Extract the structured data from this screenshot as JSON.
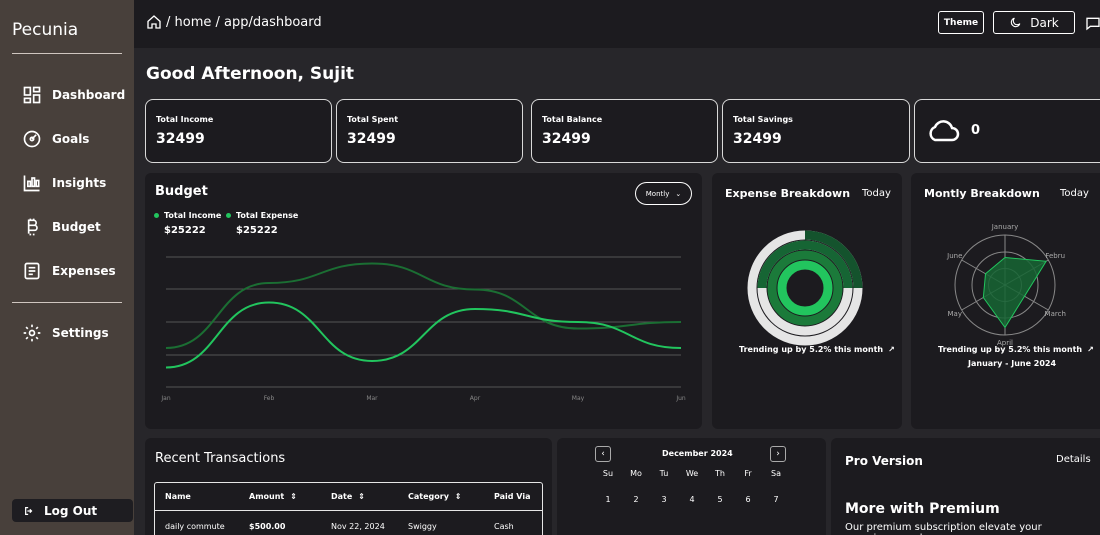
{
  "app": {
    "brand": "Pecunia"
  },
  "sidebar": {
    "items": [
      {
        "label": "Dashboard",
        "icon": "dashboard-icon"
      },
      {
        "label": "Goals",
        "icon": "goals-icon"
      },
      {
        "label": "Insights",
        "icon": "insights-icon"
      },
      {
        "label": "Budget",
        "icon": "bitcoin-icon"
      },
      {
        "label": "Expenses",
        "icon": "expenses-icon"
      },
      {
        "label": "Settings",
        "icon": "settings-icon"
      }
    ],
    "logout_label": "Log Out"
  },
  "topbar": {
    "breadcrumb": "/ home / app/dashboard",
    "theme_label": "Theme",
    "mode_label": "Dark"
  },
  "greeting": "Good Afternoon, Sujit",
  "stats": [
    {
      "label": "Total Income",
      "value": "32499"
    },
    {
      "label": "Total Spent",
      "value": "32499"
    },
    {
      "label": "Total Balance",
      "value": "32499"
    },
    {
      "label": "Total Savings",
      "value": "32499"
    }
  ],
  "weather": {
    "value": "0",
    "icon": "cloud-icon"
  },
  "budget": {
    "title": "Budget",
    "period": "Montly",
    "legend": [
      {
        "label": "Total Income",
        "value": "$25222"
      },
      {
        "label": "Total Expense",
        "value": "$25222"
      }
    ]
  },
  "expense_breakdown": {
    "title": "Expense Breakdown",
    "period": "Today",
    "trend": "Trending up by 5.2% this month"
  },
  "monthly_breakdown": {
    "title": "Montly Breakdown",
    "period": "Today",
    "trend": "Trending up by 5.2% this month",
    "range": "January - June 2024",
    "axes": [
      "January",
      "Febru",
      "March",
      "April",
      "May",
      "June"
    ]
  },
  "transactions": {
    "title": "Recent Transactions",
    "columns": [
      "Name",
      "Amount",
      "Date",
      "Category",
      "Paid Via"
    ],
    "rows": [
      {
        "name": "daily commute",
        "amount": "$500.00",
        "date": "Nov 22, 2024",
        "category": "Swiggy",
        "paid_via": "Cash"
      }
    ]
  },
  "calendar": {
    "month": "December 2024",
    "weekdays": [
      "Su",
      "Mo",
      "Tu",
      "We",
      "Th",
      "Fr",
      "Sa"
    ],
    "days": [
      "1",
      "2",
      "3",
      "4",
      "5",
      "6",
      "7"
    ]
  },
  "pro": {
    "title": "Pro Version",
    "details": "Details",
    "heading": "More with Premium",
    "text": "Our premium subscription elevate your experience and"
  },
  "chart_data": [
    {
      "type": "line",
      "x": [
        "Jan",
        "Feb",
        "Mar",
        "Apr",
        "May",
        "Jun"
      ],
      "series": [
        {
          "name": "Total Income",
          "values": [
            0.3,
            0.8,
            0.95,
            0.75,
            0.45,
            0.5
          ]
        },
        {
          "name": "Total Expense",
          "values": [
            0.15,
            0.65,
            0.2,
            0.6,
            0.5,
            0.3
          ]
        }
      ],
      "grid": true
    },
    {
      "type": "radial-bar",
      "trend": "Trending up by 5.2% this month"
    },
    {
      "type": "radar",
      "categories": [
        "January",
        "Febru",
        "March",
        "April",
        "May",
        "June"
      ]
    }
  ],
  "colors": {
    "accent": "#22c55e",
    "dark_green": "#166534",
    "panel": "#1c1b1f",
    "bg": "#27262a"
  }
}
